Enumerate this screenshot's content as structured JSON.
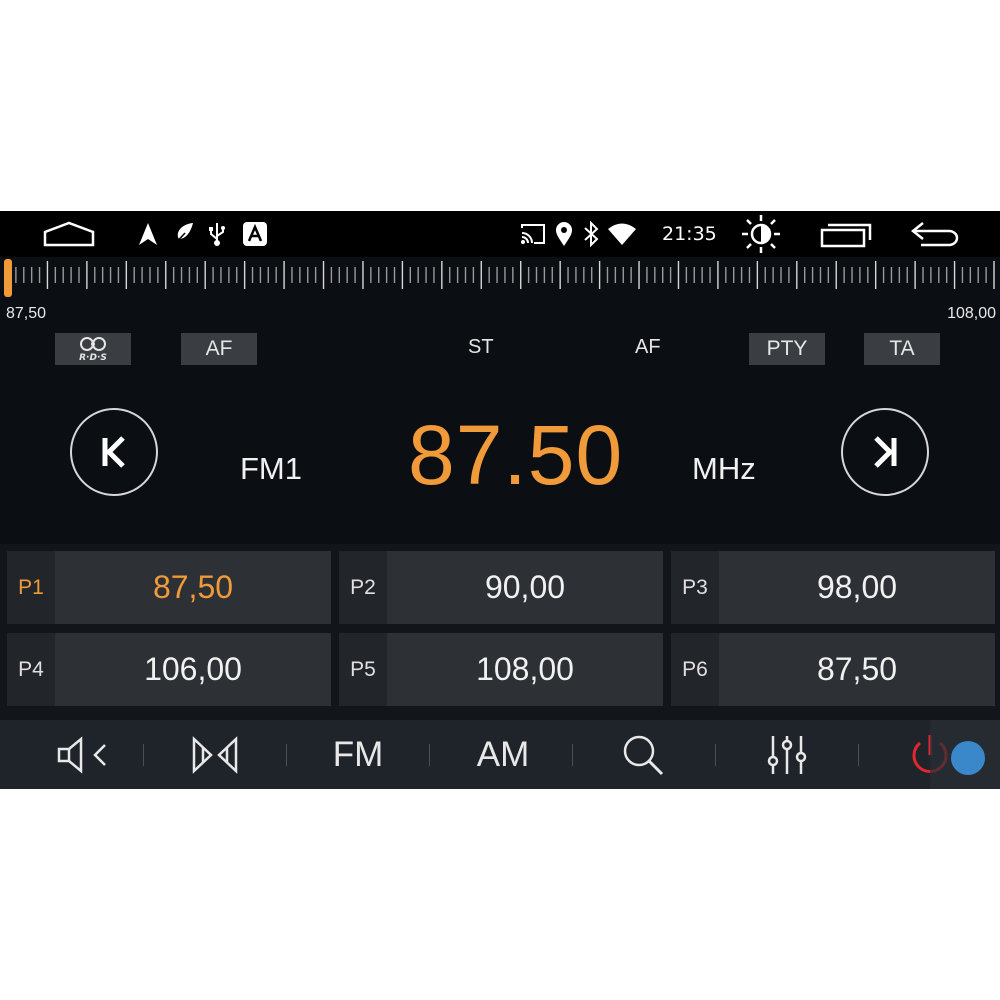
{
  "status_bar": {
    "time": "21:35",
    "left_icons": [
      "home-outline-icon",
      "navigation-arrow-icon",
      "feather-icon",
      "usb-icon",
      "carplay-a-icon"
    ],
    "right_icons": [
      "cast-icon",
      "location-pin-icon",
      "bluetooth-icon",
      "wifi-icon"
    ],
    "nav_icons": [
      "brightness-icon",
      "recent-apps-icon",
      "back-arrow-icon"
    ]
  },
  "tuner": {
    "min_label": "87,50",
    "max_label": "108,00",
    "position": 0.0
  },
  "indicators": {
    "rds_label": "R·D·S",
    "af_button": "AF",
    "st": "ST",
    "af": "AF",
    "pty_button": "PTY",
    "ta_button": "TA"
  },
  "main": {
    "band": "FM1",
    "frequency": "87.50",
    "unit": "MHz"
  },
  "presets": [
    {
      "tag": "P1",
      "value": "87,50",
      "active": true
    },
    {
      "tag": "P2",
      "value": "90,00",
      "active": false
    },
    {
      "tag": "P3",
      "value": "98,00",
      "active": false
    },
    {
      "tag": "P4",
      "value": "106,00",
      "active": false
    },
    {
      "tag": "P5",
      "value": "108,00",
      "active": false
    },
    {
      "tag": "P6",
      "value": "87,50",
      "active": false
    }
  ],
  "bottom_bar": {
    "fm_label": "FM",
    "am_label": "AM"
  },
  "colors": {
    "accent": "#f09a3a",
    "power_red": "#e0282e",
    "assistive_blue": "#3a87c9"
  }
}
